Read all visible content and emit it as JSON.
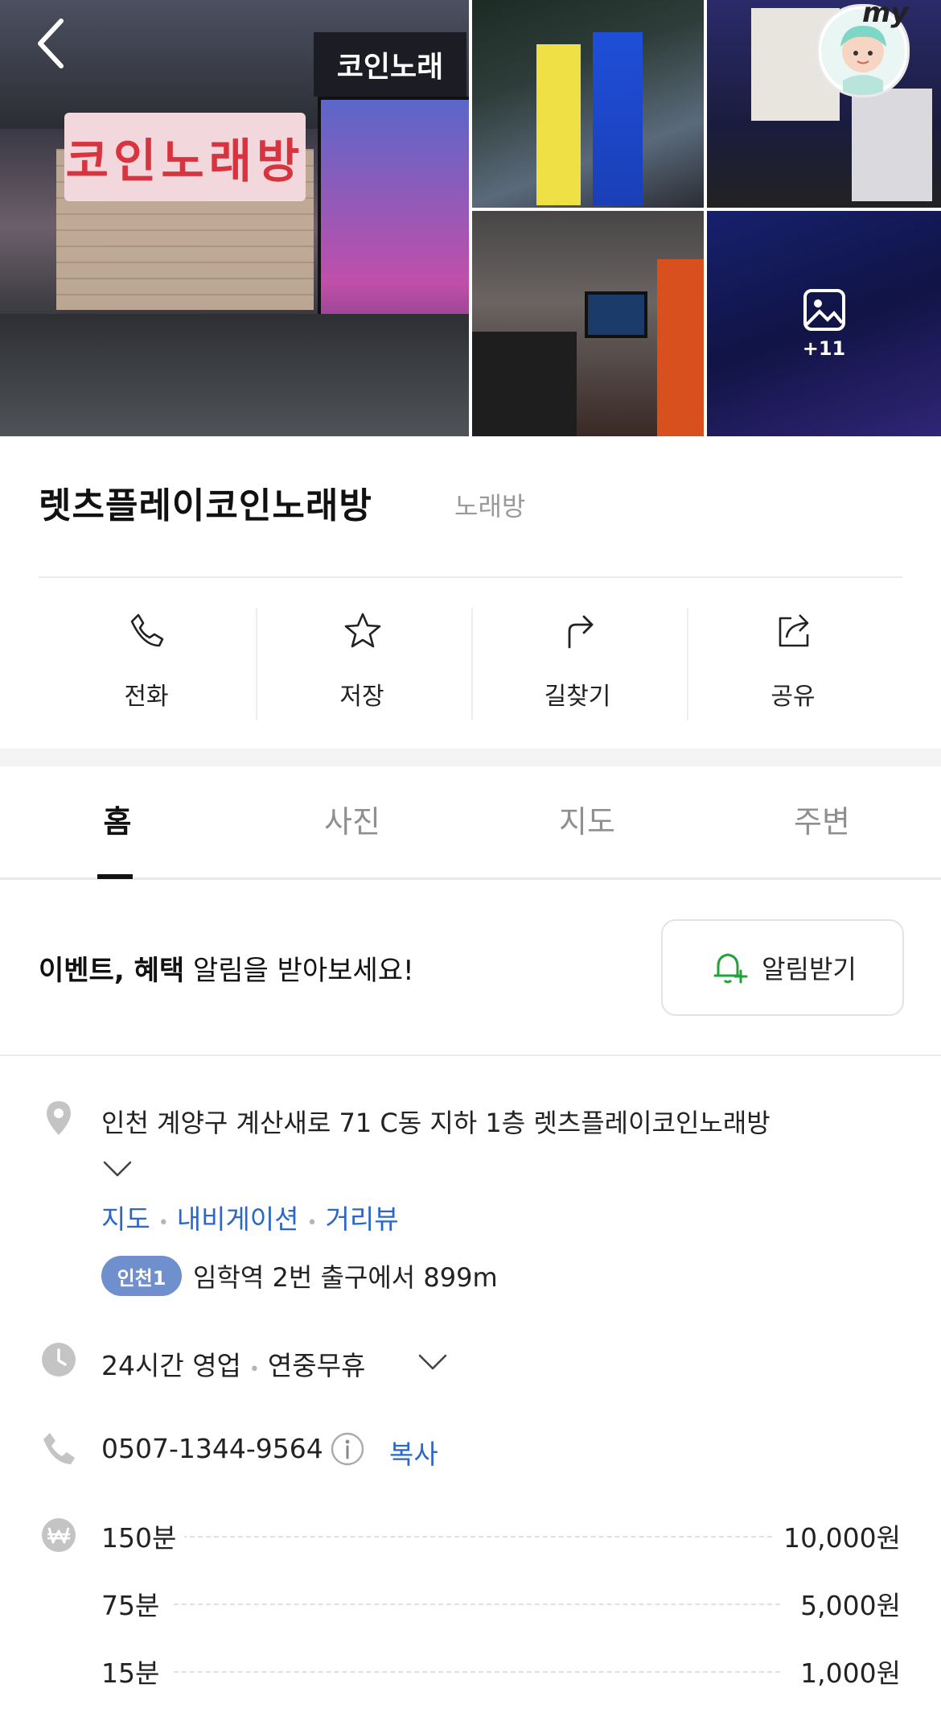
{
  "gallery": {
    "main_sign_text": "코인노래방",
    "top_sign_text": "코인노래",
    "more_count": "+11"
  },
  "header": {
    "my_label": "my"
  },
  "place": {
    "title": "렛츠플레이코인노래방",
    "category": "노래방"
  },
  "actions": [
    {
      "label": "전화",
      "icon": "phone-icon"
    },
    {
      "label": "저장",
      "icon": "star-icon"
    },
    {
      "label": "길찾기",
      "icon": "directions-icon"
    },
    {
      "label": "공유",
      "icon": "share-icon"
    }
  ],
  "tabs": [
    {
      "label": "홈",
      "active": true
    },
    {
      "label": "사진",
      "active": false
    },
    {
      "label": "지도",
      "active": false
    },
    {
      "label": "주변",
      "active": false
    }
  ],
  "notice": {
    "bold": "이벤트, 혜택",
    "rest": " 알림을 받아보세요!",
    "button_label": "알림받기",
    "accent": "#21a33a"
  },
  "info": {
    "address": "인천 계양구 계산새로 71 C동 지하 1층 렛츠플레이코인노래방",
    "links": [
      "지도",
      "내비게이션",
      "거리뷰"
    ],
    "station_badge": "인천1",
    "station_text": "임학역 2번 출구에서 899m",
    "hours_main": "24시간 영업",
    "hours_sub": "연중무휴",
    "phone": "0507-1344-9564",
    "copy_label": "복사",
    "prices": [
      {
        "name": "150분",
        "value": "10,000원"
      },
      {
        "name": "75분",
        "value": "5,000원"
      },
      {
        "name": "15분",
        "value": "1,000원"
      }
    ]
  },
  "colors": {
    "link": "#2a67c9",
    "badge": "#6f8fcd",
    "icon_gray": "#c4c4c4"
  }
}
